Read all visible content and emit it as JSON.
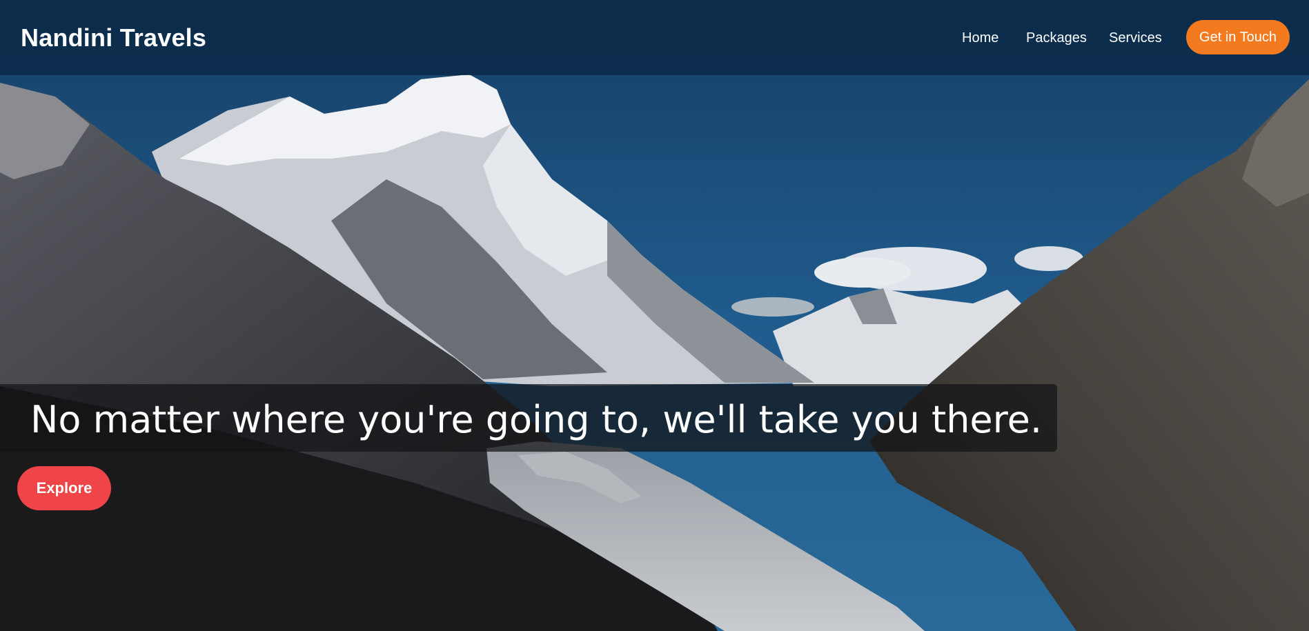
{
  "brand": {
    "name": "Nandini Travels"
  },
  "nav": {
    "items": [
      {
        "label": "Home"
      },
      {
        "label": "Packages"
      },
      {
        "label": "Services"
      }
    ],
    "cta_label": "Get in Touch"
  },
  "hero": {
    "tagline": "No matter where you're going to, we'll take you there.",
    "button_label": "Explore"
  },
  "colors": {
    "navbar": "#0a2846",
    "cta": "#f47a1f",
    "explore": "#ef4448",
    "sky": "#1e5a8a"
  },
  "icons": [
    "mountain-landscape-image"
  ]
}
